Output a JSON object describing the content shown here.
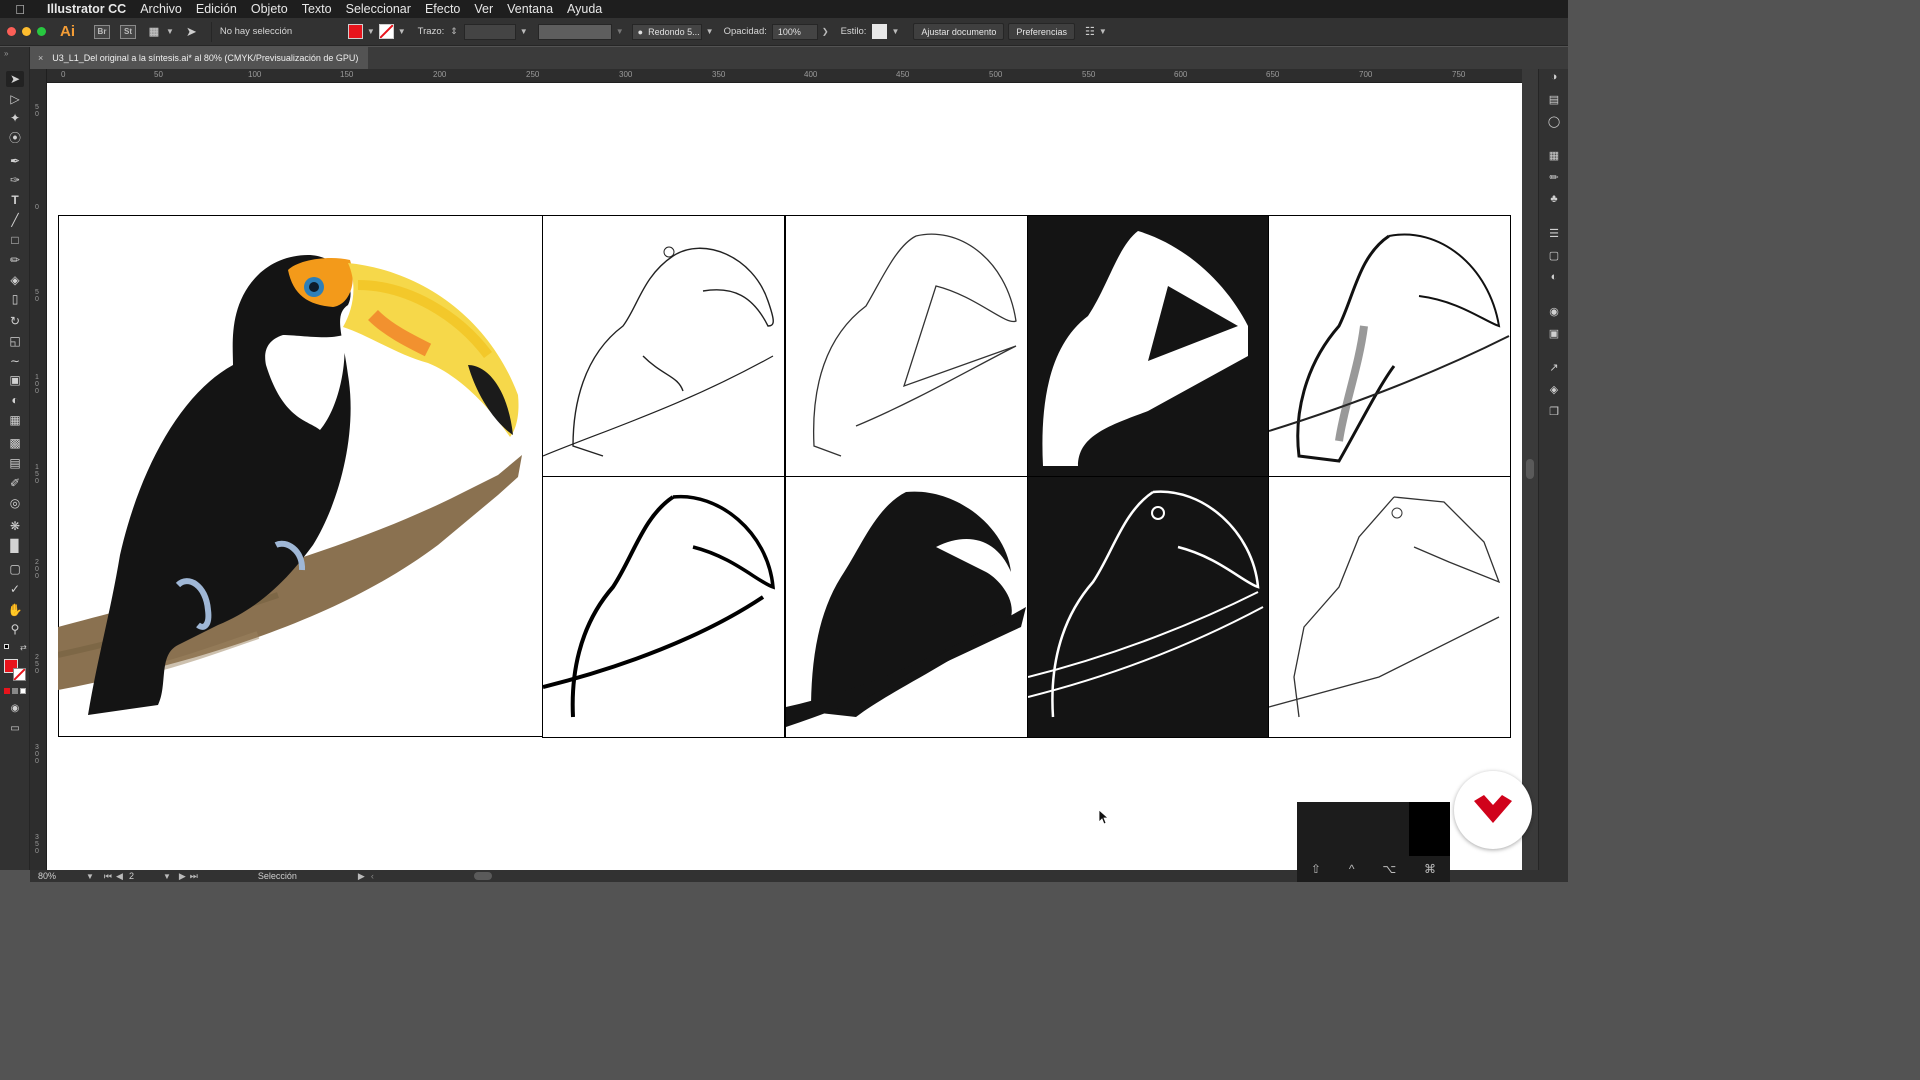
{
  "menubar": {
    "app_name": "Illustrator CC",
    "items": [
      "Archivo",
      "Edición",
      "Objeto",
      "Texto",
      "Seleccionar",
      "Efecto",
      "Ver",
      "Ventana",
      "Ayuda"
    ]
  },
  "appbar": {
    "logo": "Ai",
    "bridge": "Br",
    "stock": "St",
    "selection_status": "No hay selección",
    "fill_color": "#e8141c",
    "stroke_label": "Trazo:",
    "brush_name": "Redondo 5...",
    "opacity_label": "Opacidad:",
    "opacity_value": "100%",
    "style_label": "Estilo:",
    "fit_doc_button": "Ajustar documento",
    "prefs_button": "Preferencias"
  },
  "document": {
    "tab_title": "U3_L1_Del original a la síntesis.ai* al 80% (CMYK/Previsualización de GPU)",
    "close_symbol": "×"
  },
  "ruler": {
    "top_ticks": [
      "0",
      "50",
      "100",
      "150",
      "200",
      "250",
      "300",
      "350",
      "400",
      "450",
      "500",
      "550",
      "600",
      "650",
      "700",
      "750"
    ],
    "left_ticks": [
      "5 0",
      "0",
      "5 0",
      "1 0 0",
      "1 5 0",
      "2 0 0",
      "2 5 0",
      "3 0 0",
      "3 5 0"
    ]
  },
  "status": {
    "zoom": "80%",
    "artboard": "2",
    "tool_name": "Selección"
  },
  "artwork": {
    "thumbnails": [
      {
        "name": "outline-sketch",
        "style": "line"
      },
      {
        "name": "silhouette-outline",
        "style": "line"
      },
      {
        "name": "silhouette-inverted",
        "style": "dark"
      },
      {
        "name": "ink-shaded",
        "style": "shaded"
      },
      {
        "name": "bold-lines",
        "style": "bold"
      },
      {
        "name": "solid-black",
        "style": "solid"
      },
      {
        "name": "white-on-black",
        "style": "negative"
      },
      {
        "name": "geometric-lines",
        "style": "geometric"
      }
    ]
  },
  "keys": [
    "⇧",
    "^",
    "⌥",
    "⌘"
  ],
  "colors": {
    "accent": "#f49d36",
    "brand_red": "#d0021b"
  }
}
